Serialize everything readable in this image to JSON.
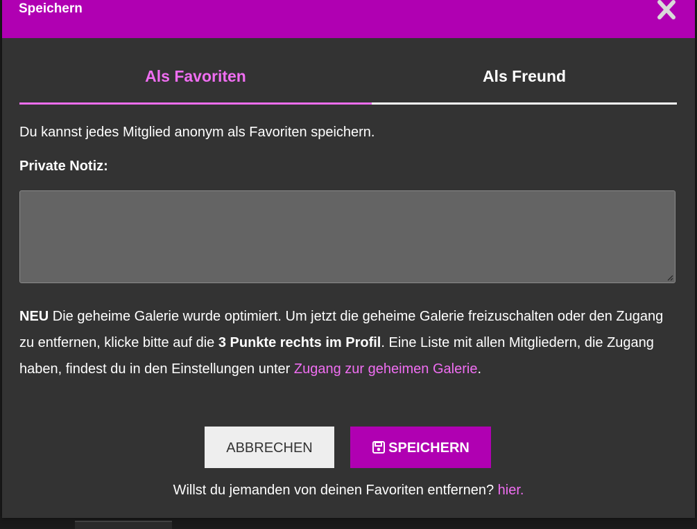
{
  "modal": {
    "title": "Speichern",
    "tabs": [
      {
        "label": "Als Favoriten",
        "active": true
      },
      {
        "label": "Als Freund",
        "active": false
      }
    ],
    "intro": "Du kannst jedes Mitglied anonym als Favoriten speichern.",
    "note_label": "Private Notiz:",
    "note_value": "",
    "news": {
      "badge": "NEU",
      "text1": " Die geheime Galerie wurde optimiert. Um jetzt die geheime Galerie freizuschalten oder den Zugang zu entfernen, klicke bitte auf die ",
      "bold": "3 Punkte rechts im Profil",
      "text2": ". Eine Liste mit allen Mitgliedern, die Zugang haben, findest du in den Einstellungen unter ",
      "link": "Zugang zur geheimen Galerie",
      "end": "."
    },
    "cancel_label": "ABBRECHEN",
    "save_label": "SPEICHERN",
    "remove_text": "Willst du jemanden von deinen Favoriten entfernen? ",
    "remove_link": "hier."
  },
  "colors": {
    "accent": "#b000b2",
    "link": "#f06ef2",
    "modal_bg": "#333333",
    "field_bg": "#646464"
  },
  "icons": {
    "close": "close-icon",
    "save": "floppy-disk-icon"
  }
}
